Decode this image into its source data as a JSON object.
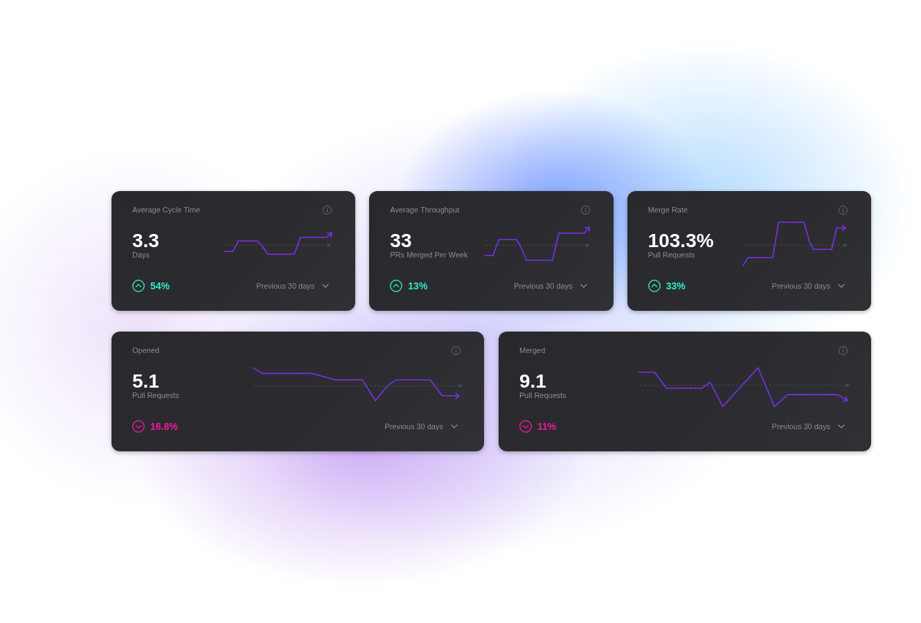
{
  "rows": [
    {
      "cards": [
        {
          "title": "Average Cycle Time",
          "value": "3.3",
          "unit": "Days",
          "rising": true,
          "change": "54%",
          "period": "Previous 30 days"
        },
        {
          "title": "Average Throughput",
          "value": "33",
          "unit": "PRs Merged Per Week",
          "rising": true,
          "change": "13%",
          "period": "Previous 30 days"
        },
        {
          "title": "Merge Rate",
          "value": "103.3%",
          "unit": "Pull Requests",
          "rising": true,
          "change": "33%",
          "period": "Previous 30 days"
        }
      ]
    },
    {
      "cards": [
        {
          "title": "Opened",
          "value": "5.1",
          "unit": "Pull Requests",
          "rising": false,
          "change": "16.8%",
          "period": "Previous 30 days"
        },
        {
          "title": "Merged",
          "value": "9.1",
          "unit": "Pull Requests",
          "rising": false,
          "change": "11%",
          "period": "Previous 30 days"
        }
      ]
    }
  ]
}
